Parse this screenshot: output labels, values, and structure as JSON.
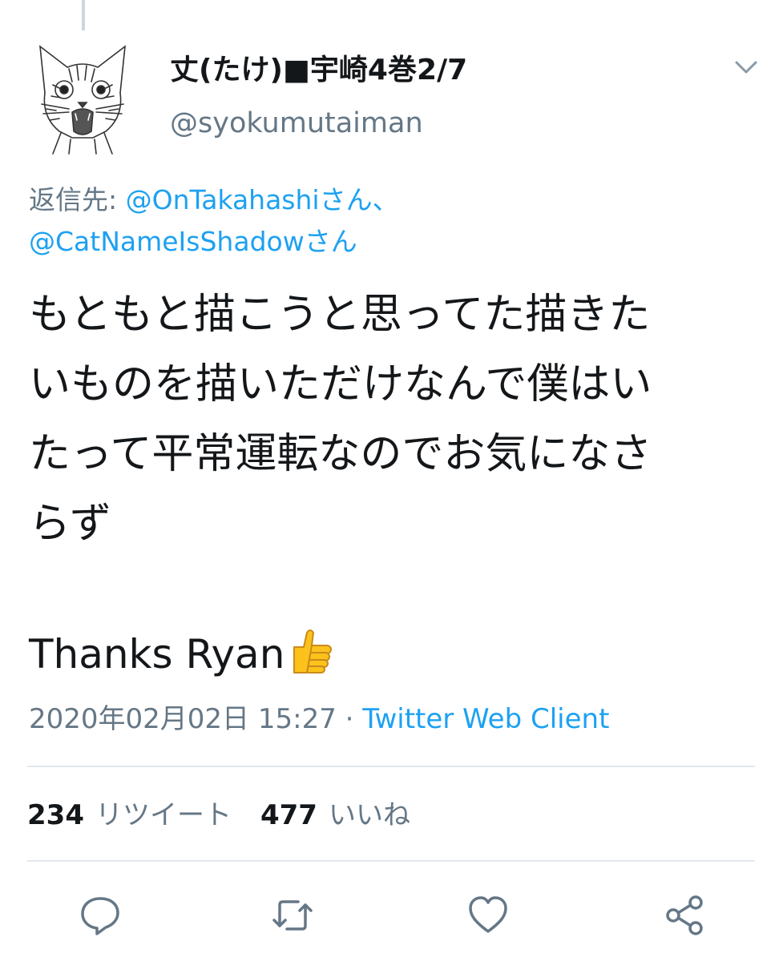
{
  "tweet": {
    "display_name": "丈(たけ)■宇崎4巻2/7",
    "handle": "@syokumutaiman",
    "reply_prefix": "返信先: ",
    "reply_to_1": "@OnTakahashiさん、",
    "reply_to_2": "@CatNameIsShadowさん",
    "text_lines": [
      "もともと描こうと思ってた描きた",
      "いものを描いただけなんで僕はい",
      "たって平常運転なのでお気になさ",
      "らず"
    ],
    "thanks_text": "Thanks Ryan",
    "emoji": "thumbs-up",
    "timestamp": "2020年02月02日 15:27",
    "separator": " · ",
    "client": "Twitter Web Client"
  },
  "stats": {
    "retweets_count": "234",
    "retweets_label": "リツイート",
    "likes_count": "477",
    "likes_label": "いいね"
  },
  "icons": {
    "avatar": "cat-avatar",
    "menu": "chevron-down-icon",
    "reply": "reply-icon",
    "retweet": "retweet-icon",
    "like": "heart-icon",
    "share": "share-icon"
  },
  "colors": {
    "text": "#14171a",
    "muted": "#657786",
    "link": "#1da1f2",
    "divider": "#e1e8ed"
  }
}
